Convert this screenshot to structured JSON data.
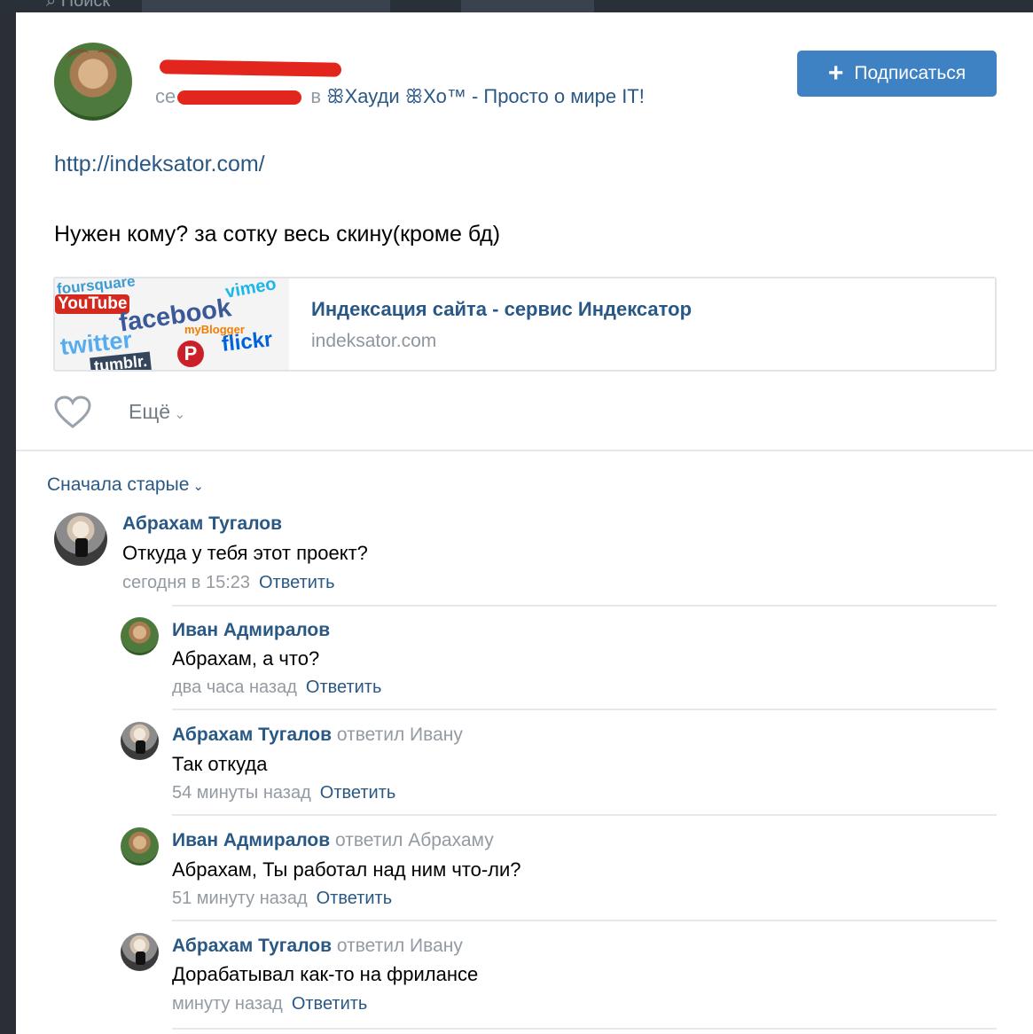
{
  "topbar": {
    "search_placeholder": "Поиск"
  },
  "post": {
    "author_name": "",
    "meta_prefix": "се",
    "meta_in": " в ",
    "group_name": "ꕥХауди ꕥХо™ - Просто о мире IT!",
    "subscribe_label": "Подписаться",
    "link": "http://indeksator.com/",
    "text": "Нужен кому? за сотку весь скину(кроме бд)",
    "snippet": {
      "title": "Индексация сайта - сервис Индексатор",
      "domain": "indeksator.com",
      "image_words": [
        "foursquare",
        "YouTube",
        "facebook",
        "vimeo",
        "twitter",
        "myBlogger",
        "flickr",
        "tumblr."
      ]
    },
    "more_label": "Ещё"
  },
  "comments_sort": "Сначала старые",
  "comments": [
    {
      "author": "Абрахам Тугалов",
      "reply_to": "",
      "text": "Откуда у тебя этот проект?",
      "time": "сегодня в 15:23",
      "reply_label": "Ответить"
    },
    {
      "author": "Иван Адмиралов",
      "reply_to": "",
      "text": "Абрахам, а что?",
      "time": "два часа назад",
      "reply_label": "Ответить"
    },
    {
      "author": "Абрахам Тугалов",
      "reply_to": "ответил Ивану",
      "text": "Так откуда",
      "time": "54 минуты назад",
      "reply_label": "Ответить"
    },
    {
      "author": "Иван Адмиралов",
      "reply_to": "ответил Абрахаму",
      "text": "Абрахам, Ты работал над ним что-ли?",
      "time": "51 минуту назад",
      "reply_label": "Ответить"
    },
    {
      "author": "Абрахам Тугалов",
      "reply_to": "ответил Ивану",
      "text": "Дорабатывал как-то на фрилансе",
      "time": "минуту назад",
      "reply_label": "Ответить"
    }
  ],
  "icons": {
    "like": "heart-icon",
    "subscribe": "plus-icon",
    "sort": "chevron-down-icon"
  }
}
